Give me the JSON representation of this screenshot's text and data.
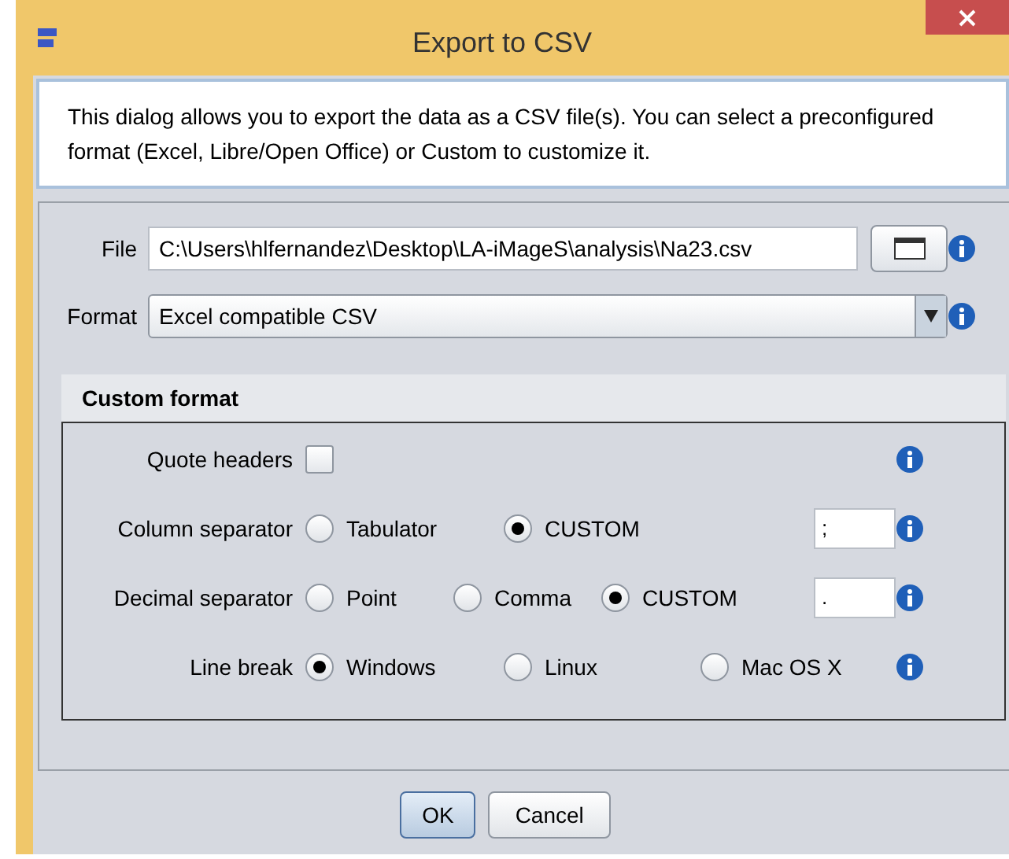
{
  "window": {
    "title": "Export to CSV"
  },
  "description": "This dialog allows you to export the data as a CSV file(s). You can select a preconfigured format (Excel, Libre/Open Office) or Custom to customize it.",
  "file": {
    "label": "File",
    "value": "C:\\Users\\hlfernandez\\Desktop\\LA-iMageS\\analysis\\Na23.csv"
  },
  "format": {
    "label": "Format",
    "value": "Excel compatible CSV"
  },
  "custom_format": {
    "title": "Custom format",
    "rows": [
      {
        "kind": "checkbox",
        "label": "Quote headers",
        "checked": false
      },
      {
        "kind": "radio",
        "label": "Column separator",
        "options": [
          {
            "label": "Tabulator",
            "selected": false
          },
          {
            "label": "CUSTOM",
            "selected": true
          }
        ],
        "custom_value": ";"
      },
      {
        "kind": "radio",
        "label": "Decimal separator",
        "options": [
          {
            "label": "Point",
            "selected": false
          },
          {
            "label": "Comma",
            "selected": false
          },
          {
            "label": "CUSTOM",
            "selected": true
          }
        ],
        "custom_value": "."
      },
      {
        "kind": "radio",
        "label": "Line break",
        "options": [
          {
            "label": "Windows",
            "selected": true
          },
          {
            "label": "Linux",
            "selected": false
          },
          {
            "label": "Mac OS X",
            "selected": false
          }
        ]
      }
    ]
  },
  "buttons": [
    {
      "label": "OK",
      "focused": true
    },
    {
      "label": "Cancel",
      "focused": false
    }
  ]
}
